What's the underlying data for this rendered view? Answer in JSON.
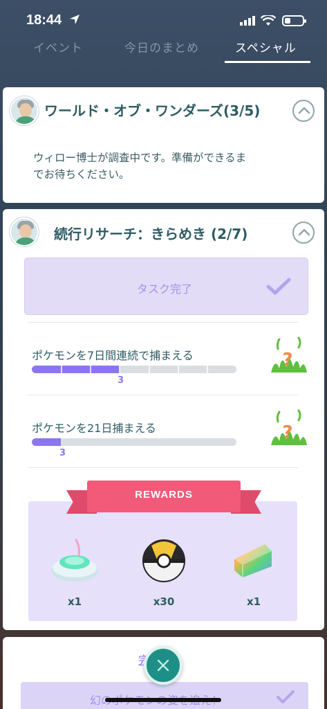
{
  "status_bar": {
    "time": "18:44"
  },
  "tabs": [
    "イベント",
    "今日のまとめ",
    "スペシャル"
  ],
  "research_card_1": {
    "title": "ワールド・オブ・ワンダーズ(3/5)",
    "description": "ウィロー博士が調査中です。準備ができるまでお待ちください。"
  },
  "research_card_2": {
    "title": "続行リサーチ：きらめき (2/7)",
    "completed_task_label": "タスク完了",
    "tasks": [
      {
        "label": "ポケモンを7日間連続で捕まえる",
        "progress": 3,
        "goal": 7,
        "count": "3"
      },
      {
        "label": "ポケモンを21日捕まえる",
        "progress": 3,
        "goal": 21,
        "count": "3"
      }
    ],
    "rewards_label": "REWARDS",
    "rewards": [
      {
        "icon": "incense-icon",
        "qty": "x1"
      },
      {
        "icon": "ultra-ball-icon",
        "qty": "x30"
      },
      {
        "icon": "rare-candy-xl-icon",
        "qty": "x1"
      }
    ]
  },
  "research_card_3": {
    "complete_link": "完了済み",
    "task_label": "幻のポケモンの姿を追え！"
  },
  "colors": {
    "accent": "#8b76ed",
    "ribbon": "#f25a7a",
    "teal_text": "#2e5b63",
    "fab": "#1e8f86"
  }
}
